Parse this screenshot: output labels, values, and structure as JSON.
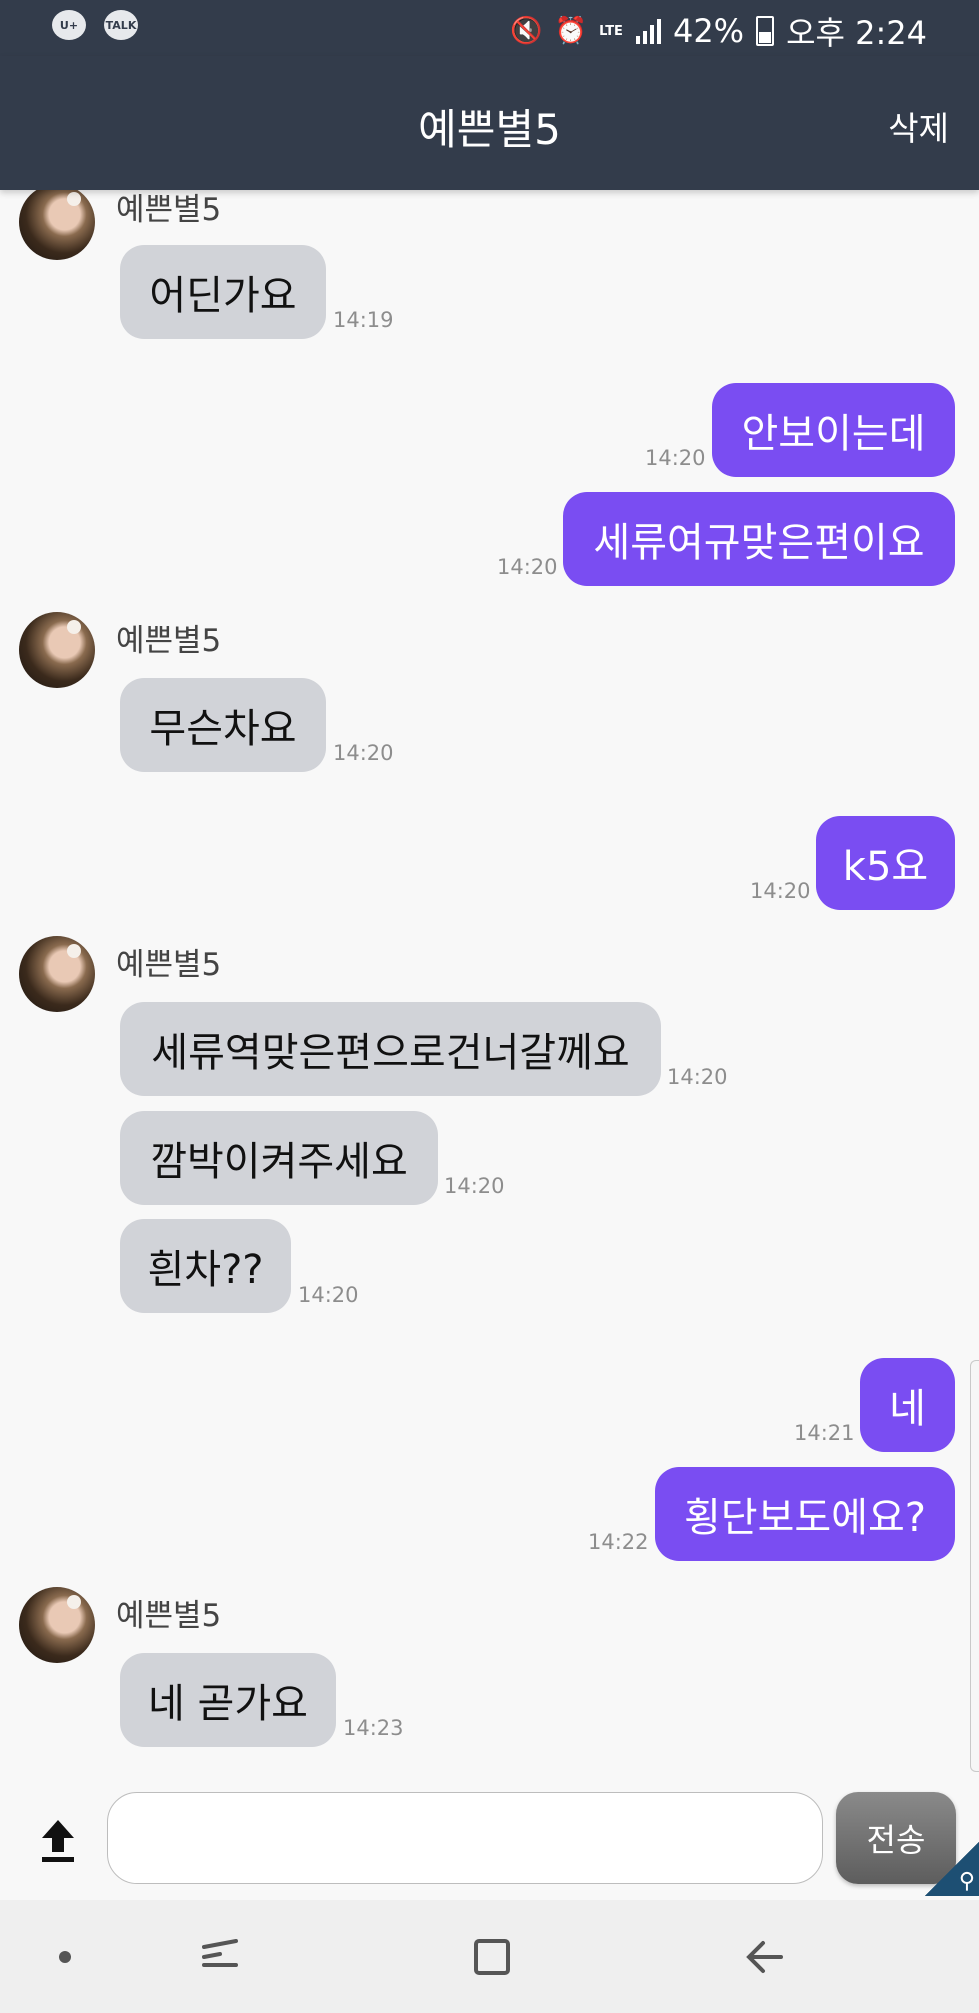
{
  "status_bar": {
    "app_badges": [
      "U+",
      "TALK"
    ],
    "signal_type": "LTE",
    "battery": "42%",
    "time": "오후 2:24"
  },
  "header": {
    "title": "예쁜별5",
    "delete_label": "삭제"
  },
  "messages": [
    {
      "type": "received",
      "sender": "예쁜별5",
      "text": "어딘가요",
      "time": "14:19"
    },
    {
      "type": "sent",
      "text": "안보이는데",
      "time": "14:20"
    },
    {
      "type": "sent",
      "text": "세류여규맞은편이요",
      "time": "14:20"
    },
    {
      "type": "received",
      "sender": "예쁜별5",
      "text": "무슨차요",
      "time": "14:20"
    },
    {
      "type": "sent",
      "text": "k5요",
      "time": "14:20"
    },
    {
      "type": "received",
      "sender": "예쁜별5",
      "text": "세류역맞은편으로건너갈께요",
      "time": "14:20"
    },
    {
      "type": "received",
      "text": "깜박이켜주세요",
      "time": "14:20"
    },
    {
      "type": "received",
      "text": "흰차??",
      "time": "14:20"
    },
    {
      "type": "sent",
      "text": "네",
      "time": "14:21"
    },
    {
      "type": "sent",
      "text": "횡단보도에요?",
      "time": "14:22"
    },
    {
      "type": "received",
      "sender": "예쁜별5",
      "text": "네 곧가요",
      "time": "14:23"
    }
  ],
  "input_bar": {
    "placeholder": "",
    "value": "",
    "send_label": "전송"
  },
  "icons": {
    "upload": "upload-icon",
    "nav": [
      "dot-icon",
      "recents-icon",
      "home-icon",
      "back-icon"
    ]
  },
  "colors": {
    "header": "#333c4b",
    "sent_bubble": "#7a4df2",
    "received_bubble": "#d1d3d8"
  }
}
